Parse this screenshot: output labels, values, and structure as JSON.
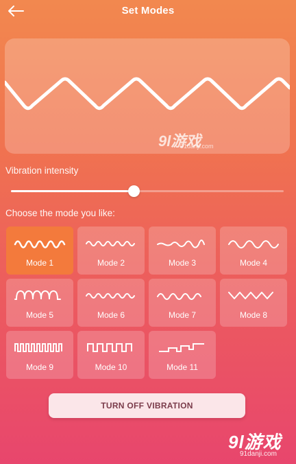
{
  "header": {
    "title": "Set Modes",
    "back_icon": "arrow-left-icon"
  },
  "preview": {
    "waveform_icon": "zigzag-wave-icon"
  },
  "intensity": {
    "label": "Vibration intensity",
    "value_fraction": 0.45
  },
  "modes": {
    "label": "Choose the mode you like:",
    "selected_index": 0,
    "items": [
      {
        "label": "Mode 1",
        "icon": "dense-wave-icon"
      },
      {
        "label": "Mode 2",
        "icon": "fine-wave-icon"
      },
      {
        "label": "Mode 3",
        "icon": "rising-wave-icon"
      },
      {
        "label": "Mode 4",
        "icon": "loose-wave-icon"
      },
      {
        "label": "Mode 5",
        "icon": "pulse-wave-icon"
      },
      {
        "label": "Mode 6",
        "icon": "fine-wave-icon"
      },
      {
        "label": "Mode 7",
        "icon": "medium-wave-icon"
      },
      {
        "label": "Mode 8",
        "icon": "zigzag-wave-icon"
      },
      {
        "label": "Mode 9",
        "icon": "dense-square-wave-icon"
      },
      {
        "label": "Mode 10",
        "icon": "square-wave-icon"
      },
      {
        "label": "Mode 11",
        "icon": "step-wave-icon"
      }
    ]
  },
  "actions": {
    "turn_off_label": "TURN OFF VIBRATION"
  },
  "watermarks": {
    "mid_logo": "9l游戏",
    "mid_site": "91danji.com",
    "corner_logo": "9l游戏",
    "corner_site": "91danji.com"
  }
}
